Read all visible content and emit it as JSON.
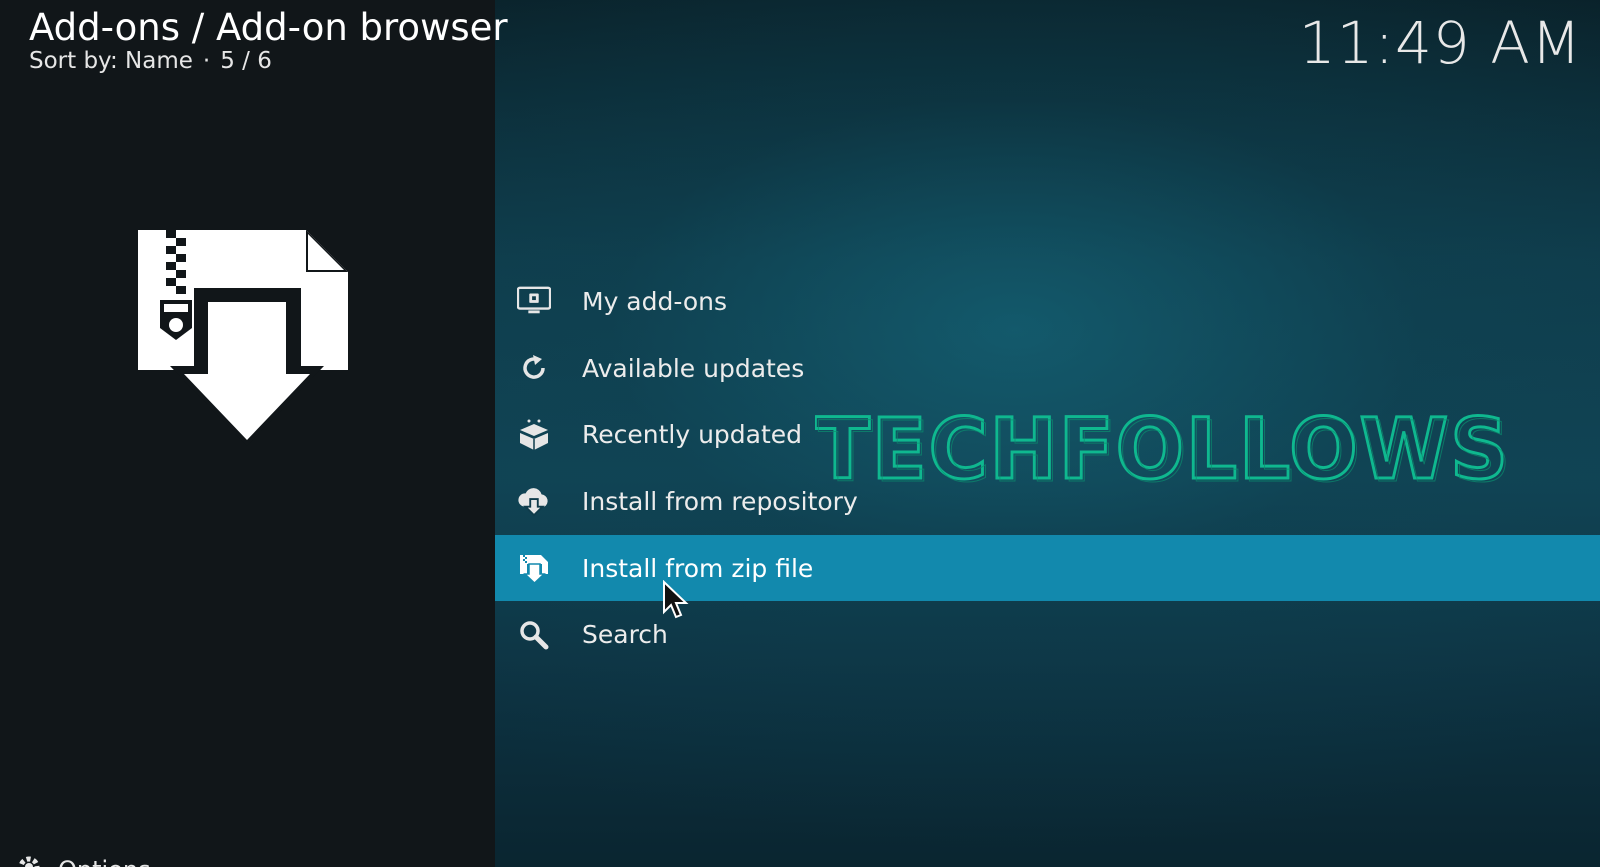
{
  "header": {
    "title": "Add-ons / Add-on browser",
    "sort_label": "Sort by: Name",
    "separator": "·",
    "position": "5 / 6"
  },
  "clock": "11:49 AM",
  "menu": {
    "items": [
      {
        "label": "My add-ons",
        "icon": "monitor-addons-icon"
      },
      {
        "label": "Available updates",
        "icon": "refresh-icon"
      },
      {
        "label": "Recently updated",
        "icon": "open-box-icon"
      },
      {
        "label": "Install from repository",
        "icon": "cloud-download-icon"
      },
      {
        "label": "Install from zip file",
        "icon": "zip-download-icon",
        "selected": true
      },
      {
        "label": "Search",
        "icon": "search-icon"
      }
    ]
  },
  "watermark": "TECHFOLLOWS",
  "footer": {
    "options_label": "Options"
  },
  "colors": {
    "selection": "#1289ad",
    "watermark": "#0fb88f",
    "left_panel": "#111619"
  }
}
